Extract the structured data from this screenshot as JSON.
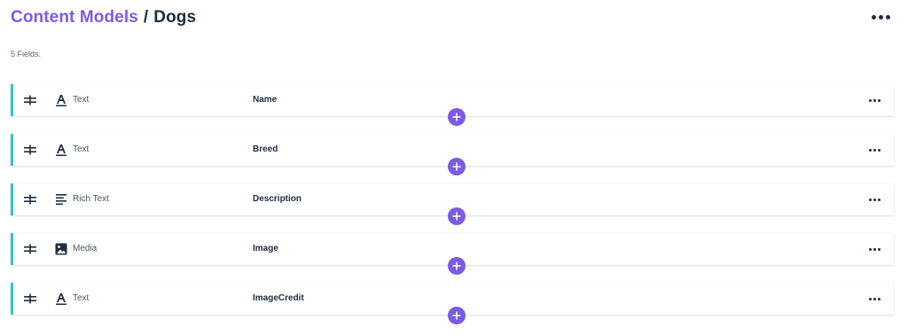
{
  "breadcrumb": {
    "parent": "Content Models",
    "separator": "/",
    "current": "Dogs"
  },
  "field_count": "5 Fields.",
  "fields": [
    {
      "type": "Text",
      "type_icon": "text-format-icon",
      "name": "Name"
    },
    {
      "type": "Text",
      "type_icon": "text-format-icon",
      "name": "Breed"
    },
    {
      "type": "Rich Text",
      "type_icon": "rich-text-icon",
      "name": "Description"
    },
    {
      "type": "Media",
      "type_icon": "image-icon",
      "name": "Image"
    },
    {
      "type": "Text",
      "type_icon": "text-format-icon",
      "name": "ImageCredit"
    }
  ],
  "colors": {
    "accent": "#7b5ce0",
    "row_border": "#2dc7c0",
    "text_dark": "#1f2d3d"
  }
}
